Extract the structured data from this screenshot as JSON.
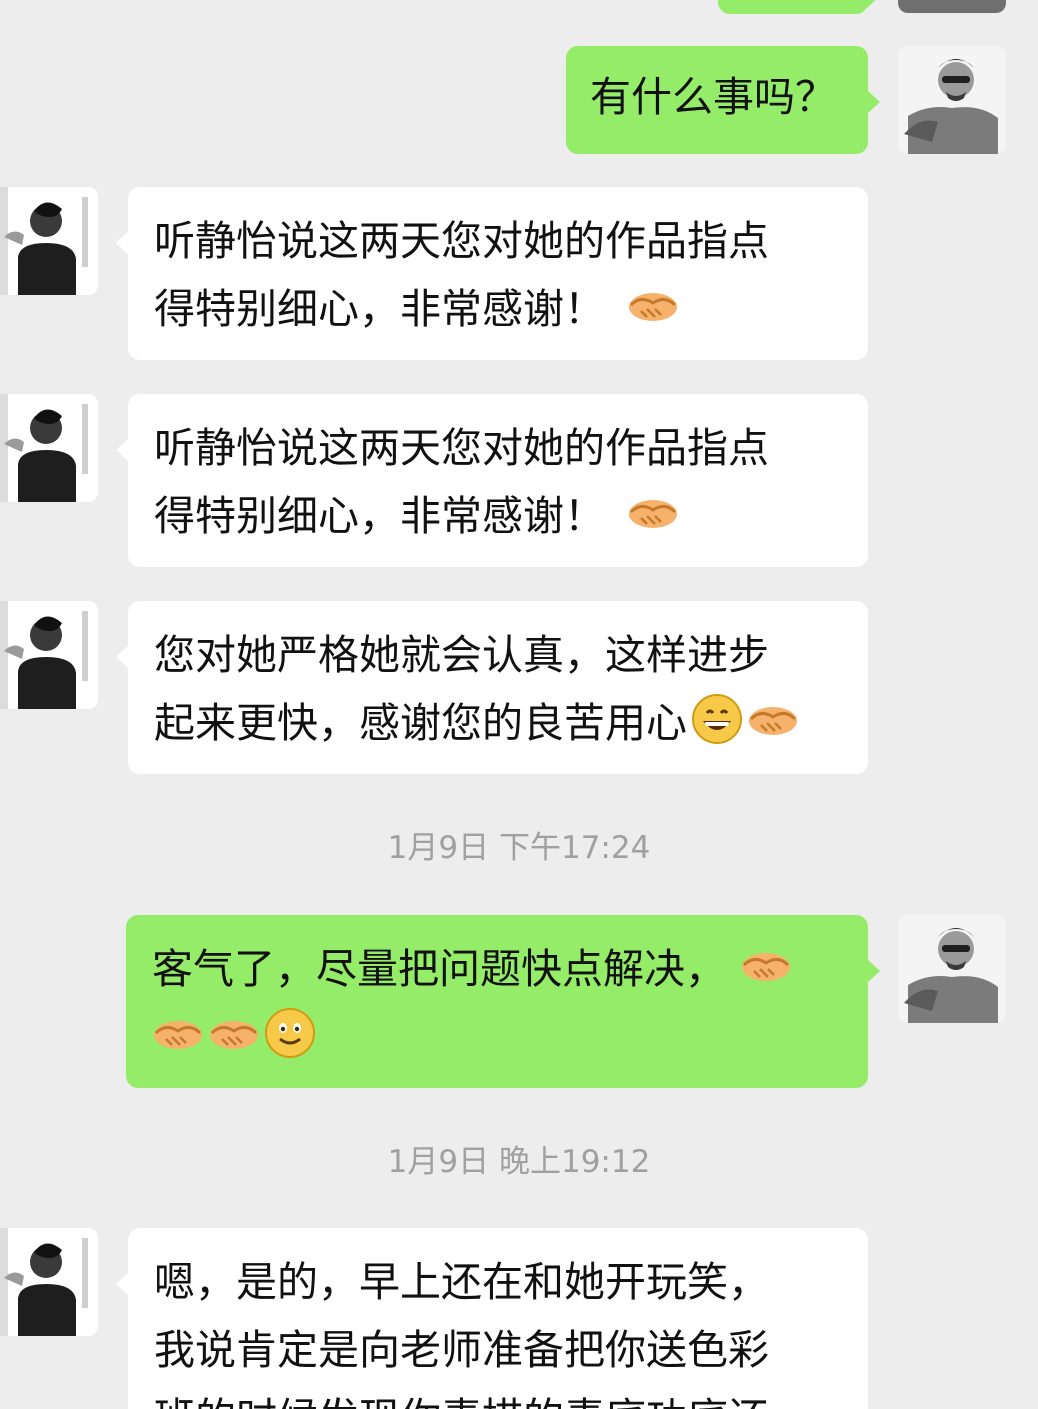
{
  "messages": [
    {
      "side": "sent",
      "text": "有什么事吗？"
    },
    {
      "side": "recv",
      "line1": "听静怡说这两天您对她的作品指点",
      "line2": "得特别细心，非常感谢！",
      "emoji": [
        "handshake-icon"
      ]
    },
    {
      "side": "recv",
      "line1": "听静怡说这两天您对她的作品指点",
      "line2": "得特别细心，非常感谢！",
      "emoji": [
        "handshake-icon"
      ]
    },
    {
      "side": "recv",
      "line1": "您对她严格她就会认真，这样进步",
      "line2": "起来更快，感谢您的良苦用心",
      "emoji": [
        "grinning-face-icon",
        "handshake-icon"
      ]
    },
    {
      "side": "sent",
      "line1": "客气了，尽量把问题快点解决，",
      "emoji": [
        "handshake-icon",
        "handshake-icon",
        "handshake-icon",
        "smiling-face-icon"
      ]
    },
    {
      "side": "recv",
      "line1": "嗯，是的，早上还在和她开玩笑，",
      "line2": "我说肯定是向老师准备把你送色彩",
      "line3": "班的时候发现你素描的素底功底还"
    }
  ],
  "timestamps": {
    "first": "1月9日 下午17:24",
    "second": "1月9日 晚上19:12"
  },
  "colors": {
    "background": "#ededed",
    "sent_bubble": "#95ec69",
    "received_bubble": "#ffffff",
    "timestamp_text": "#a0a0a0"
  }
}
